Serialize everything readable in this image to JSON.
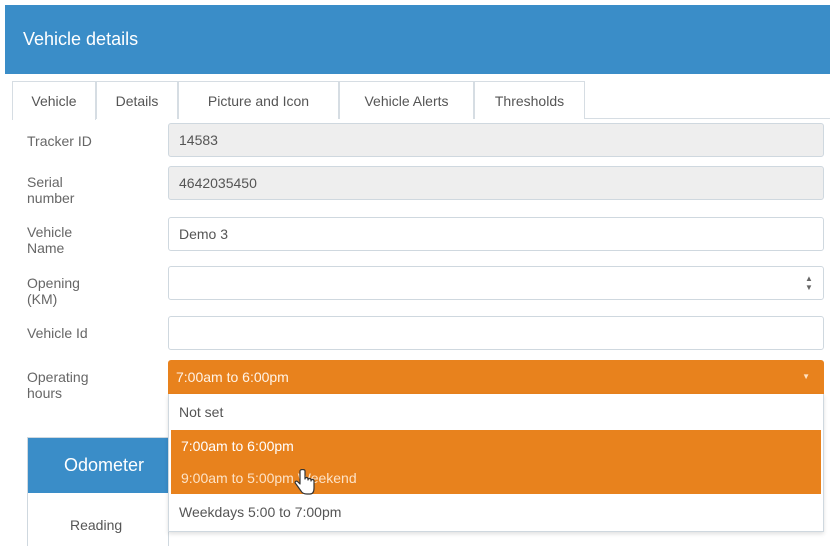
{
  "header": {
    "title": "Vehicle details"
  },
  "tabs": [
    {
      "label": "Vehicle",
      "active": true
    },
    {
      "label": "Details"
    },
    {
      "label": "Picture and Icon"
    },
    {
      "label": "Vehicle Alerts"
    },
    {
      "label": "Thresholds"
    }
  ],
  "form": {
    "tracker_id": {
      "label": "Tracker ID",
      "value": "14583"
    },
    "serial_number": {
      "label_line1": "Serial",
      "label_line2": "number",
      "value": "4642035450"
    },
    "vehicle_name": {
      "label_line1": "Vehicle",
      "label_line2": "Name",
      "value": "Demo 3"
    },
    "opening_km": {
      "label_line1": "Opening",
      "label_line2": "(KM)",
      "value": ""
    },
    "vehicle_id": {
      "label": "Vehicle Id",
      "value": ""
    },
    "operating_hours": {
      "label_line1": "Operating",
      "label_line2": "hours",
      "selected": "7:00am to 6:00pm",
      "options": [
        "Not set",
        "7:00am to 6:00pm",
        "9:00am to 5:00pm Weekend",
        "Weekdays 5:00 to 7:00pm"
      ]
    }
  },
  "odometer": {
    "title": "Odometer",
    "reading_label": "Reading"
  },
  "colors": {
    "header": "#3a8dc8",
    "accent": "#e8821d"
  },
  "icons": {
    "spinner": "spinner-arrows-icon",
    "caret": "caret-down-icon",
    "cursor": "hand-pointer-icon"
  }
}
